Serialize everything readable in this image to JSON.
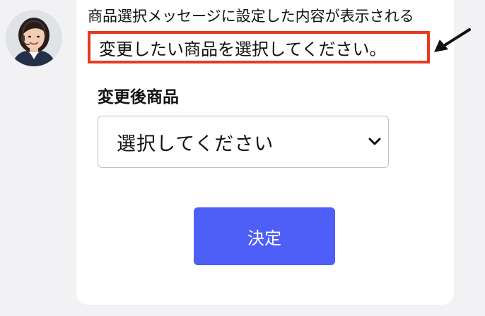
{
  "annotation": {
    "caption": "商品選択メッセージに設定した内容が表示される",
    "highlight_color": "#e63a1e"
  },
  "message": {
    "text": "変更したい商品を選択してください。"
  },
  "form": {
    "field_label": "変更後商品",
    "select": {
      "selected": "選択してください"
    },
    "submit_label": "決定",
    "accent_color": "#4d5ff7"
  },
  "icons": {
    "avatar": "operator-avatar",
    "arrow": "pointer-arrow-icon",
    "dropdown": "chevron-down-icon"
  }
}
